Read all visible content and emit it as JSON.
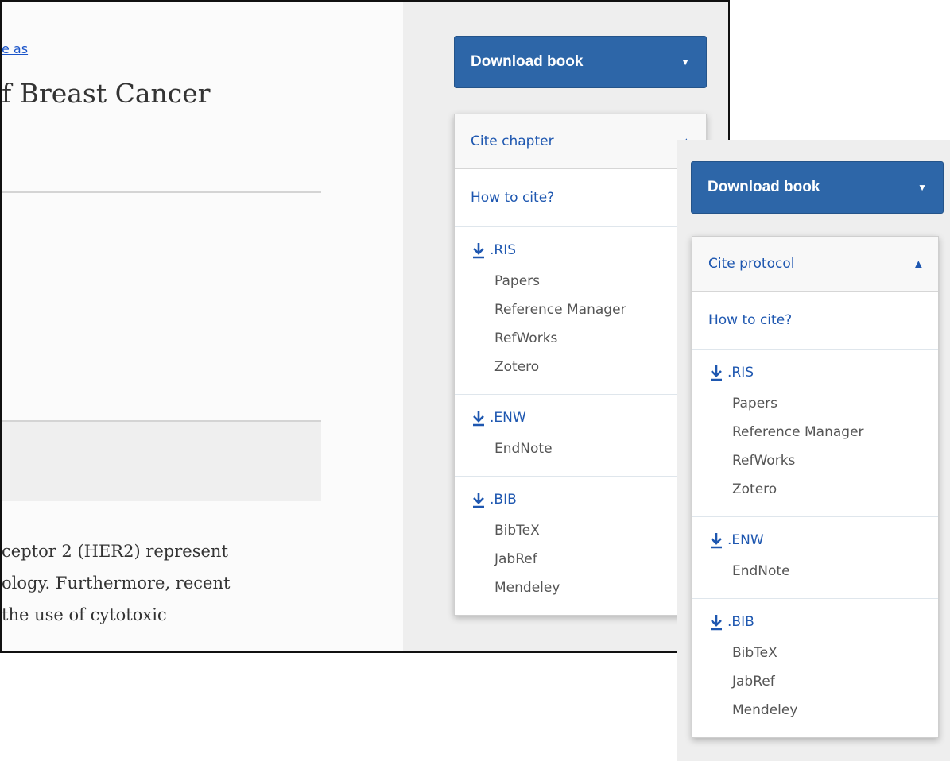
{
  "panel_a": {
    "save_link": "e as",
    "title": "f Breast Cancer",
    "abstract_lines": [
      "ceptor 2 (HER2) represent",
      "ology. Furthermore, recent",
      "the use of cytotoxic"
    ],
    "download_label": "Download book",
    "cite_header": "Cite chapter",
    "how_to_cite": "How to cite?",
    "formats": [
      {
        "ext": ".RIS",
        "tools": [
          "Papers",
          "Reference Manager",
          "RefWorks",
          "Zotero"
        ]
      },
      {
        "ext": ".ENW",
        "tools": [
          "EndNote"
        ]
      },
      {
        "ext": ".BIB",
        "tools": [
          "BibTeX",
          "JabRef",
          "Mendeley"
        ]
      }
    ]
  },
  "panel_b": {
    "download_label": "Download book",
    "cite_header": "Cite protocol",
    "how_to_cite": "How to cite?",
    "formats": [
      {
        "ext": ".RIS",
        "tools": [
          "Papers",
          "Reference Manager",
          "RefWorks",
          "Zotero"
        ]
      },
      {
        "ext": ".ENW",
        "tools": [
          "EndNote"
        ]
      },
      {
        "ext": ".BIB",
        "tools": [
          "BibTeX",
          "JabRef",
          "Mendeley"
        ]
      }
    ]
  },
  "icons": {
    "download": "download-icon",
    "caret_down": "caret-down-icon",
    "caret_up": "caret-up-icon"
  },
  "colors": {
    "accent": "#2d66a8",
    "link": "#1e57b0",
    "tool_text": "#555555",
    "sidebar_bg": "#eeeeee"
  }
}
